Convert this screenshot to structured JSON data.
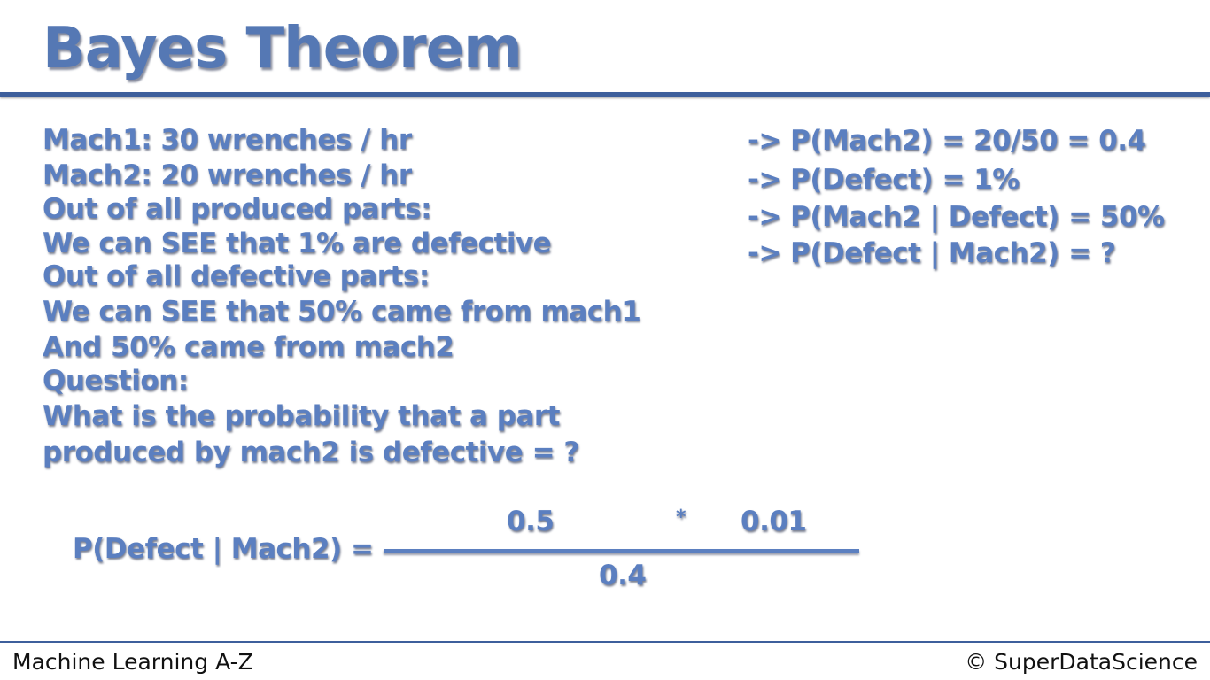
{
  "title": "Bayes Theorem",
  "left_lines": [
    "Mach1: 30 wrenches / hr",
    "Mach2: 20 wrenches / hr",
    "Out of all produced parts:",
    "We can SEE that 1% are defective",
    "Out of all defective parts:",
    "We can SEE that 50% came from mach1",
    "And 50% came from mach2",
    "Question:",
    "What is the probability that a part",
    "produced by mach2 is defective = ?"
  ],
  "right_lines": [
    "-> P(Mach2) = 20/50 = 0.4",
    "-> P(Defect) = 1%",
    "-> P(Mach2 | Defect) = 50%",
    "-> P(Defect | Mach2) = ?"
  ],
  "equation": {
    "label": "P(Defect | Mach2) =",
    "numerator_a": "0.5",
    "operator": "*",
    "numerator_b": "0.01",
    "denominator": "0.4"
  },
  "footer": {
    "left": "Machine Learning A-Z",
    "right": "© SuperDataScience"
  },
  "colors": {
    "accent": "#5b7fc0",
    "rule": "#3d5f9c",
    "background": "#ffffff"
  }
}
